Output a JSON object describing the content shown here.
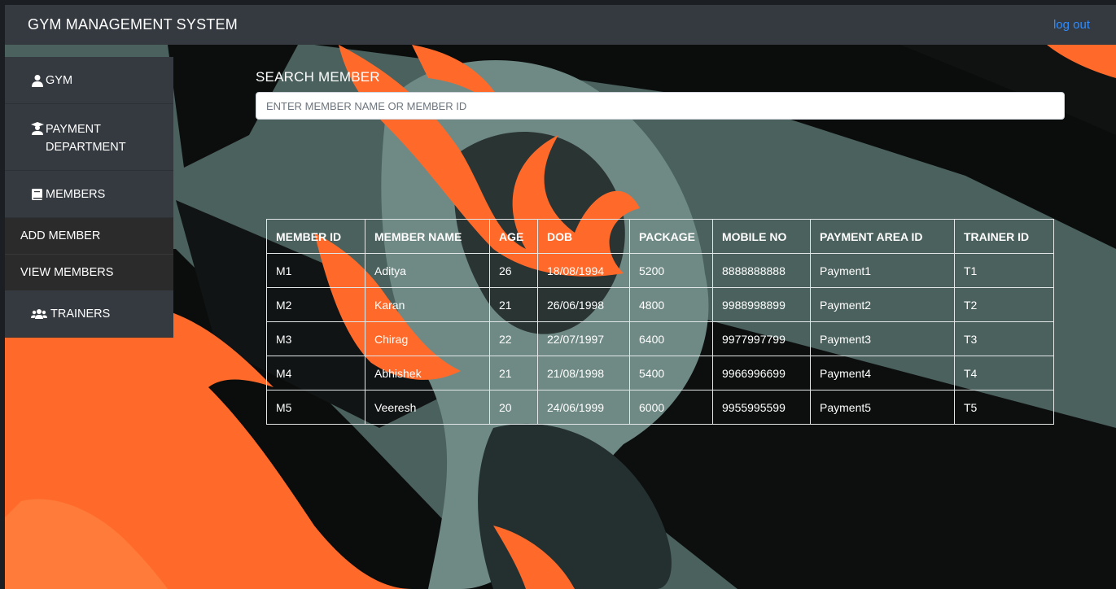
{
  "navbar": {
    "brand": "GYM MANAGEMENT SYSTEM",
    "logout": "log out"
  },
  "sidebar": {
    "items": [
      {
        "label": "GYM",
        "icon": "user-icon"
      },
      {
        "label": "PAYMENT DEPARTMENT",
        "icon": "graduate-icon"
      },
      {
        "label": "MEMBERS",
        "icon": "book-icon"
      },
      {
        "label": "TRAINERS",
        "icon": "users-icon"
      }
    ],
    "members_submenu": [
      "ADD MEMBER",
      "VIEW MEMBERS"
    ]
  },
  "search": {
    "label": "SEARCH MEMBER",
    "placeholder": "ENTER MEMBER NAME OR MEMBER ID",
    "value": ""
  },
  "table": {
    "headers": [
      "MEMBER ID",
      "MEMBER NAME",
      "AGE",
      "DOB",
      "PACKAGE",
      "MOBILE NO",
      "PAYMENT AREA ID",
      "TRAINER ID"
    ],
    "rows": [
      [
        "M1",
        "Aditya",
        "26",
        "18/08/1994",
        "5200",
        "8888888888",
        "Payment1",
        "T1"
      ],
      [
        "M2",
        "Karan",
        "21",
        "26/06/1998",
        "4800",
        "9988998899",
        "Payment2",
        "T2"
      ],
      [
        "M3",
        "Chirag",
        "22",
        "22/07/1997",
        "6400",
        "9977997799",
        "Payment3",
        "T3"
      ],
      [
        "M4",
        "Abhishek",
        "21",
        "21/08/1998",
        "5400",
        "9966996699",
        "Payment4",
        "T4"
      ],
      [
        "M5",
        "Veeresh",
        "20",
        "24/06/1999",
        "6000",
        "9955995599",
        "Payment5",
        "T5"
      ]
    ]
  },
  "colors": {
    "navbar": "#343a40",
    "background": "#4a615d",
    "accent_orange": "#ff6a2a",
    "link": "#2f8cff"
  }
}
